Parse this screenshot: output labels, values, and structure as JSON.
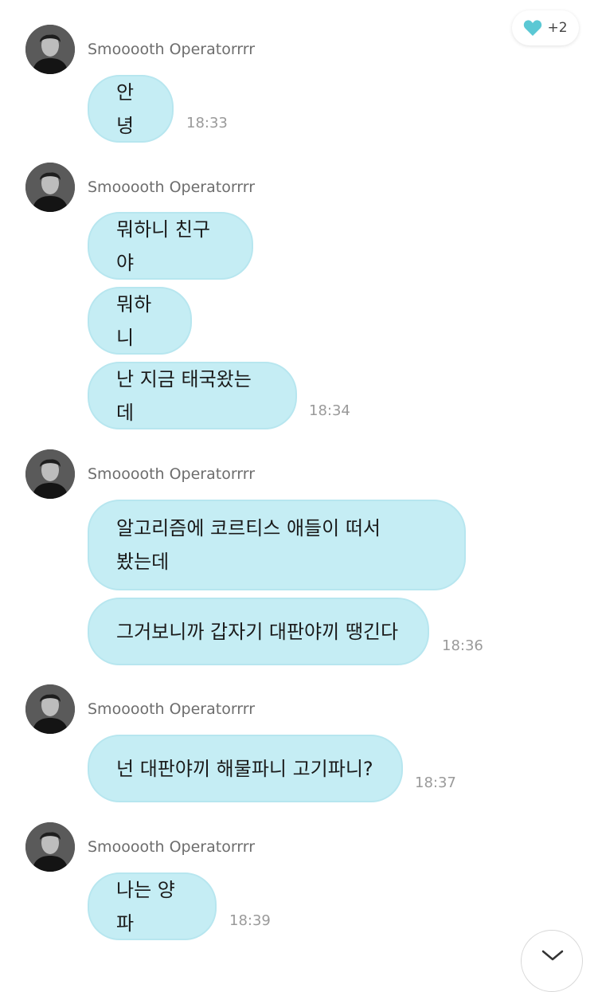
{
  "reaction": {
    "icon": "heart-icon",
    "count": "+2",
    "color": "#5bc8d4"
  },
  "sender_name": "Smooooth Operatorrrr",
  "bubble_color": "#c5edf4",
  "groups": [
    {
      "messages": [
        "안녕"
      ],
      "time": "18:33"
    },
    {
      "messages": [
        "뭐하니 친구야",
        "뭐하니",
        "난 지금 태국왔는데"
      ],
      "time": "18:34"
    },
    {
      "messages": [
        "알고리즘에 코르티스 애들이 떠서\n봤는데",
        "그거보니까 갑자기 대판야끼 땡긴다"
      ],
      "time": "18:36"
    },
    {
      "messages": [
        "넌 대판야끼 해물파니 고기파니?"
      ],
      "time": "18:37"
    },
    {
      "messages": [
        "나는 양파"
      ],
      "time": "18:39"
    }
  ],
  "scroll_button": {
    "icon": "chevron-down-icon"
  }
}
